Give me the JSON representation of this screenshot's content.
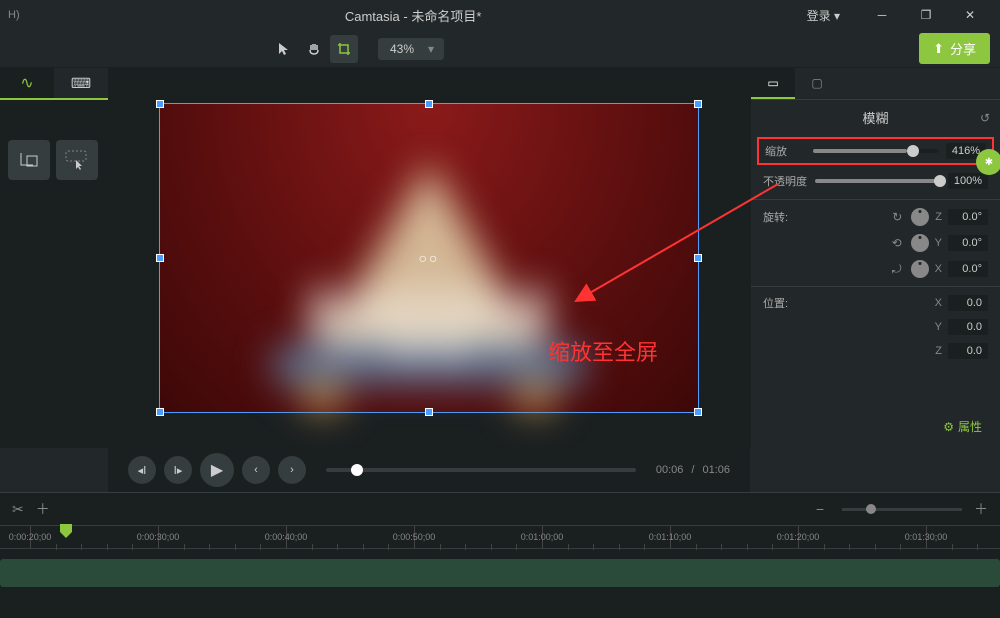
{
  "titlebar": {
    "menu_hint": "H)",
    "title": "Camtasia - 未命名项目*",
    "login": "登录 ▾"
  },
  "toolbar": {
    "zoom": "43%",
    "share": "分享"
  },
  "canvas": {
    "center_marker": "○○",
    "annotation_text": "缩放至全屏"
  },
  "playback": {
    "current_time": "00:06",
    "separator": "/",
    "total_time": "01:06",
    "properties_label": "属性"
  },
  "properties": {
    "header": "模糊",
    "zoom_label": "缩放",
    "zoom_value": "416%",
    "opacity_label": "不透明度",
    "opacity_value": "100%",
    "rotation_label": "旋转:",
    "rot_z": "Z",
    "rot_z_val": "0.0°",
    "rot_y": "Y",
    "rot_y_val": "0.0°",
    "rot_x": "X",
    "rot_x_val": "0.0°",
    "position_label": "位置:",
    "pos_x": "X",
    "pos_x_val": "0.0",
    "pos_y": "Y",
    "pos_y_val": "0.0",
    "pos_z": "Z",
    "pos_z_val": "0.0"
  },
  "timeline": {
    "ticks": [
      "0:00:20;00",
      "0:00:30;00",
      "0:00:40;00",
      "0:00:50;00",
      "0:01:00;00",
      "0:01:10;00",
      "0:01:20;00",
      "0:01:30;00"
    ]
  }
}
